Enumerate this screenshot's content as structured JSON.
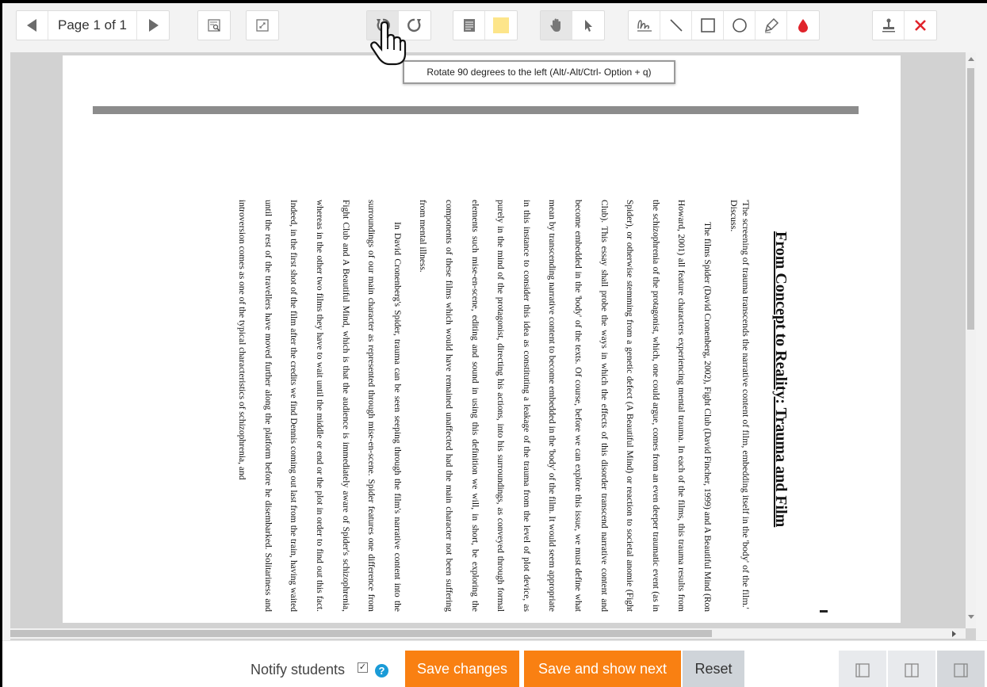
{
  "toolbar": {
    "page_label": "Page 1 of 1",
    "buttons": [
      {
        "name": "prev-page",
        "icon": "triangle-left-icon"
      },
      {
        "name": "next-page",
        "icon": "triangle-right-icon"
      },
      {
        "name": "search-comments",
        "icon": "search-comments-icon"
      },
      {
        "name": "expand-view",
        "icon": "expand-icon"
      },
      {
        "name": "rotate-left",
        "icon": "rotate-left-icon"
      },
      {
        "name": "rotate-right",
        "icon": "rotate-right-icon"
      },
      {
        "name": "comment",
        "icon": "comment-icon"
      },
      {
        "name": "color",
        "icon": "color-swatch-icon"
      },
      {
        "name": "pan",
        "icon": "hand-icon"
      },
      {
        "name": "select",
        "icon": "arrow-pointer-icon"
      },
      {
        "name": "pen",
        "icon": "pen-icon"
      },
      {
        "name": "line",
        "icon": "line-icon"
      },
      {
        "name": "rectangle",
        "icon": "rectangle-icon"
      },
      {
        "name": "oval",
        "icon": "oval-icon"
      },
      {
        "name": "highlight",
        "icon": "highlighter-icon"
      },
      {
        "name": "annotation-color",
        "icon": "drop-icon"
      },
      {
        "name": "stamp",
        "icon": "stamp-icon"
      },
      {
        "name": "delete",
        "icon": "close-icon"
      }
    ],
    "colors": {
      "accent_red": "#e0232b",
      "swatch": "#fde58a"
    }
  },
  "tooltip": {
    "text": "Rotate 90 degrees to the left (Alt/-Alt/Ctrl- Option + q)"
  },
  "document": {
    "title": "From Concept to Reality: Trauma and Film",
    "prompt": "'The screening of trauma transcends the narrative content of film, embedding itself in the 'body' of the film.' Discuss.",
    "paragraphs": [
      "The films Spider (David Cronenberg, 2002), Fight Club (David Fincher, 1999) and A Beautiful Mind (Ron Howard, 2001) all feature characters experiencing mental trauma. In each of the films, this trauma results from the schizophrenia of the protagonist, which, one could argue, comes from an even deeper traumatic event (as in Spider), or otherwise stemming from a genetic defect (A Beautiful Mind) or reaction to societal anomie (Fight Club). This essay shall probe the ways in which the effects of this disorder transcend narrative content and become embedded in the 'body' of the texts. Of course, before we can explore this issue, we must define what mean by transcending narrative content to become embedded in the 'body' of the film. It would seem appropriate in this instance to consider this idea as constituting a leakage of the trauma from the level of plot device, as purely in the mind of the protagonist, directing his actions, into his surroundings, as conveyed through formal elements such mise-en-scene, editing and sound in using this definition we will, in short, be exploring the components of these films which would have remained unaffected had the main character not been suffering from mental illness.",
      "In David Cronenberg's Spider, trauma can be seen seeping through the film's narrative content into the surroundings of our main character as represented through mise-en-scene. Spider features one difference from Fight Club and A Beautiful Mind, which is that the audience is immediately aware of Spider's schizophrenia, whereas in the other two films they have to wait until the middle or end or the plot in order to find out this fact. Indeed, in the first shot of the film after the credits we find Dennis coming out last from the train, having waited until the rest of the travellers have moved further along the platform before he disembarked. Solitariness and introversion comes as one of the typical characteristics of schizophrenia, and"
    ]
  },
  "footer": {
    "notify_label": "Notify students",
    "notify_checked": true,
    "save_label": "Save changes",
    "save_next_label": "Save and show next",
    "reset_label": "Reset",
    "colors": {
      "orange": "#f98012",
      "reset_bg": "#cfd4d9",
      "help": "#1a9bd7"
    }
  }
}
